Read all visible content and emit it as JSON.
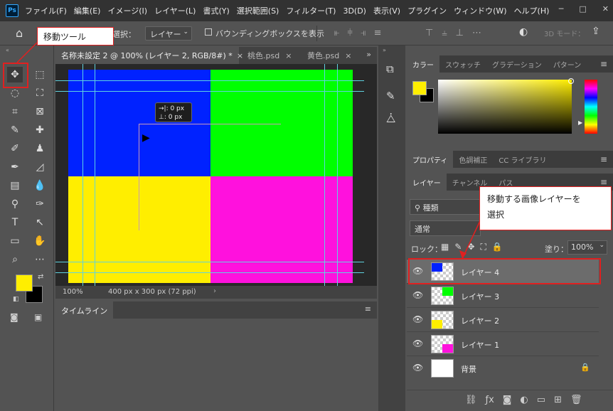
{
  "app": {
    "logo": "Ps"
  },
  "menu": [
    "ファイル(F)",
    "編集(E)",
    "イメージ(I)",
    "レイヤー(L)",
    "書式(Y)",
    "選択範囲(S)",
    "フィルター(T)",
    "3D(D)",
    "表示(V)",
    "プラグイン",
    "ウィンドウ(W)",
    "ヘルプ(H)"
  ],
  "window_controls": {
    "minimize": "─",
    "maximize": "□",
    "close": "✕"
  },
  "options_bar": {
    "auto_select_label": "選択：",
    "auto_select_value": "レイヤー",
    "bounding_box_label": "バウンディングボックスを表示",
    "mode_3d_label": "3D モード："
  },
  "doc_tabs": [
    {
      "label": "名称未設定 2 @ 100% (レイヤー 2, RGB/8#) *",
      "close": "×"
    },
    {
      "label": "桃色.psd",
      "close": "×"
    },
    {
      "label": "黄色.psd",
      "close": "×"
    }
  ],
  "canvas": {
    "colors": {
      "top_left": "#0022ff",
      "top_right": "#00ff00",
      "bottom_left": "#ffee00",
      "bottom_right": "#ff11dd"
    },
    "tooltip": {
      "x": "→|: 0 px",
      "y": "⊥: 0 px"
    }
  },
  "status_bar": {
    "zoom": "100%",
    "doc_info": "400 px x 300 px (72 ppi)"
  },
  "timeline": {
    "title": "タイムライン"
  },
  "color_panel": {
    "tabs": [
      "カラー",
      "スウォッチ",
      "グラデーション",
      "パターン"
    ],
    "foreground": "#ffee00",
    "background": "#000000"
  },
  "properties_panel": {
    "tabs": [
      "プロパティ",
      "色調補正",
      "CC ライブラリ"
    ]
  },
  "layers_panel": {
    "tabs": [
      "レイヤー",
      "チャンネル",
      "パス"
    ],
    "filter_label": "種類",
    "blend_mode": "通常",
    "lock_label": "ロック：",
    "fill_label": "塗り：",
    "fill_value": "100%",
    "layers": [
      {
        "name": "レイヤー 4",
        "color": "#0022ff",
        "selected": true,
        "corner": "top-left"
      },
      {
        "name": "レイヤー 3",
        "color": "#00ff00",
        "selected": false,
        "corner": "top-right"
      },
      {
        "name": "レイヤー 2",
        "color": "#ffee00",
        "selected": false,
        "corner": "bottom-left"
      },
      {
        "name": "レイヤー 1",
        "color": "#ff11dd",
        "selected": false,
        "corner": "bottom-right"
      },
      {
        "name": "背景",
        "color": "#ffffff",
        "selected": false,
        "corner": "full",
        "locked": true
      }
    ]
  },
  "annotations": {
    "move_tool": "移動ツール",
    "select_layer_line1": "移動する画像レイヤーを",
    "select_layer_line2": "選択"
  }
}
